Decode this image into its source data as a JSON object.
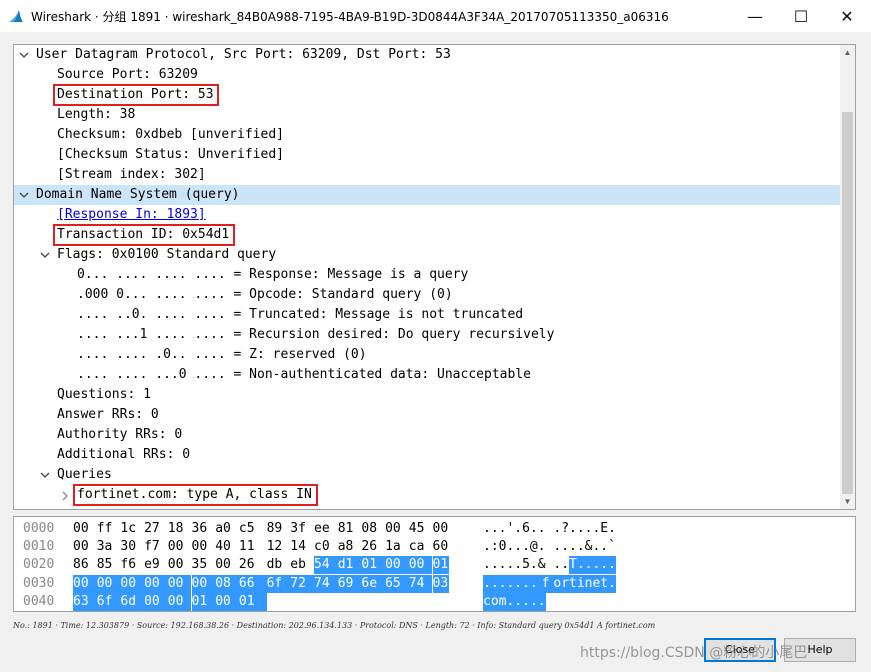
{
  "window": {
    "title": "Wireshark · 分组 1891 · wireshark_84B0A988-7195-4BA9-B19D-3D0844A3F34A_20170705113350_a06316",
    "minimize_symbol": "—",
    "maximize_symbol": "☐",
    "close_symbol": "✕",
    "app_icon": "wireshark-fin-icon"
  },
  "tree": [
    {
      "text": "User Datagram Protocol, Src Port: 63209, Dst Port: 53",
      "level": 0,
      "expander": "expanded"
    },
    {
      "text": "Source Port: 63209",
      "level": 1
    },
    {
      "text": "Destination Port: 53",
      "level": 1,
      "highlight": true
    },
    {
      "text": "Length: 38",
      "level": 1
    },
    {
      "text": "Checksum: 0xdbeb [unverified]",
      "level": 1
    },
    {
      "text": "[Checksum Status: Unverified]",
      "level": 1
    },
    {
      "text": "[Stream index: 302]",
      "level": 1
    },
    {
      "text": "Domain Name System (query)",
      "level": 0,
      "expander": "expanded",
      "selected": true
    },
    {
      "text": "[Response In: 1893]",
      "level": 1,
      "link": true
    },
    {
      "text": "Transaction ID: 0x54d1",
      "level": 1,
      "highlight": true
    },
    {
      "text": "Flags: 0x0100 Standard query",
      "level": 1,
      "expander": "expanded"
    },
    {
      "text": "0... .... .... .... = Response: Message is a query",
      "level": 2
    },
    {
      "text": ".000 0... .... .... = Opcode: Standard query (0)",
      "level": 2
    },
    {
      "text": ".... ..0. .... .... = Truncated: Message is not truncated",
      "level": 2
    },
    {
      "text": ".... ...1 .... .... = Recursion desired: Do query recursively",
      "level": 2
    },
    {
      "text": ".... .... .0.. .... = Z: reserved (0)",
      "level": 2
    },
    {
      "text": ".... .... ...0 .... = Non-authenticated data: Unacceptable",
      "level": 2
    },
    {
      "text": "Questions: 1",
      "level": 1
    },
    {
      "text": "Answer RRs: 0",
      "level": 1
    },
    {
      "text": "Authority RRs: 0",
      "level": 1
    },
    {
      "text": "Additional RRs: 0",
      "level": 1
    },
    {
      "text": "Queries",
      "level": 1,
      "expander": "expanded"
    },
    {
      "text": "fortinet.com: type A, class IN",
      "level": 2,
      "expander": "collapsed",
      "highlight": true
    }
  ],
  "hex": [
    {
      "offset": "0000",
      "bytes": [
        "00",
        "ff",
        "1c",
        "27",
        "18",
        "36",
        "a0",
        "c5",
        "89",
        "3f",
        "ee",
        "81",
        "08",
        "00",
        "45",
        "00"
      ],
      "ascii": "...'.6.. .?....E.",
      "sel_from": null
    },
    {
      "offset": "0010",
      "bytes": [
        "00",
        "3a",
        "30",
        "f7",
        "00",
        "00",
        "40",
        "11",
        "12",
        "14",
        "c0",
        "a8",
        "26",
        "1a",
        "ca",
        "60"
      ],
      "ascii": ".:0...@. ....&..`",
      "sel_from": null
    },
    {
      "offset": "0020",
      "bytes": [
        "86",
        "85",
        "f6",
        "e9",
        "00",
        "35",
        "00",
        "26",
        "db",
        "eb",
        "54",
        "d1",
        "01",
        "00",
        "00",
        "01"
      ],
      "ascii": ".....5.& ..T.....",
      "sel_from": 10
    },
    {
      "offset": "0030",
      "bytes": [
        "00",
        "00",
        "00",
        "00",
        "00",
        "00",
        "08",
        "66",
        "6f",
        "72",
        "74",
        "69",
        "6e",
        "65",
        "74",
        "03"
      ],
      "ascii": ".......f ortinet.",
      "sel_from": 0
    },
    {
      "offset": "0040",
      "bytes": [
        "63",
        "6f",
        "6d",
        "00",
        "00",
        "01",
        "00",
        "01"
      ],
      "ascii": "com.....",
      "sel_from": 0
    }
  ],
  "status": "No.: 1891 · Time: 12.303879 · Source: 192.168.38.26 · Destination: 202.96.134.133 · Protocol: DNS · Length: 72 · Info: Standard query 0x54d1 A fortinet.com",
  "buttons": {
    "close_label": "Close",
    "help_label": "Help"
  },
  "watermark": "https://blog.CSDN @粉心的小尾巴"
}
